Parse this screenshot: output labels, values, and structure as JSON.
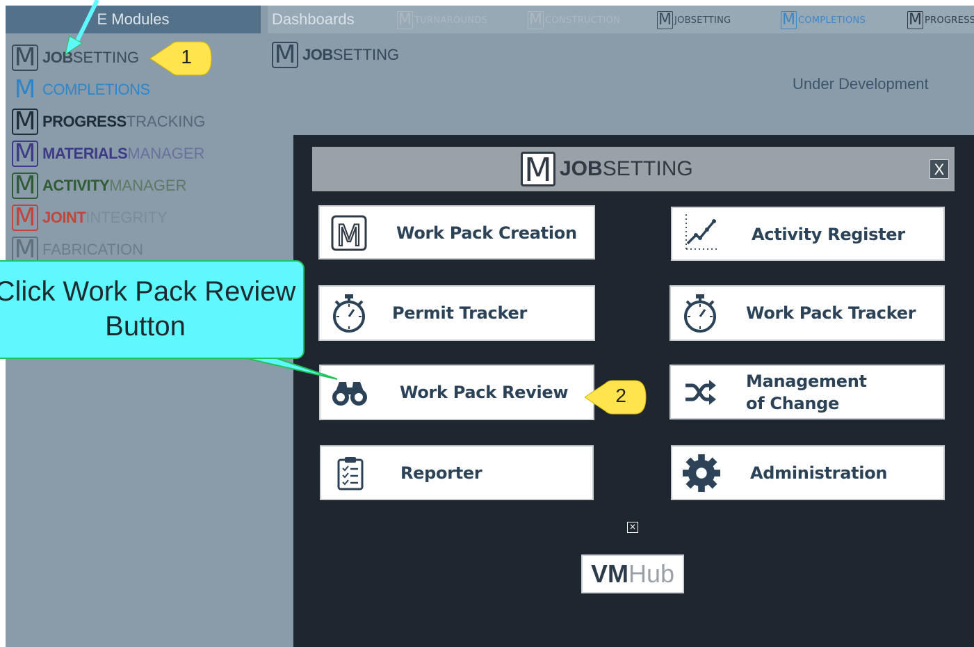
{
  "modules_header": "E Modules",
  "topnav": {
    "dashboards": "Dashboards",
    "modules": [
      {
        "m": "M",
        "label": "TURNAROUNDS",
        "color": "#aeb8c1"
      },
      {
        "m": "M",
        "label": "CONSTRUCTION",
        "color": "#aeb8c1"
      },
      {
        "m": "M",
        "label": "JOBSETTING",
        "color": "#3a4b5a"
      },
      {
        "m": "M",
        "label": "COMPLETIONS",
        "color": "#3a86c9"
      },
      {
        "m": "M",
        "label": "PROGRESS",
        "color": "#2f3a44"
      }
    ]
  },
  "sidebar": {
    "items": [
      {
        "m": "M",
        "bold": "JOB",
        "light": "SETTING",
        "color": "#3a4b5a",
        "light_color": "#3a4b5a"
      },
      {
        "m": "M",
        "bold": "COMPLETIONS",
        "light": "",
        "color": "#2c86cc",
        "light_color": "#2c86cc"
      },
      {
        "m": "M",
        "bold": "PROGRESS",
        "light": "TRACKING",
        "color": "#1f2d38",
        "light_color": "#55667a"
      },
      {
        "m": "M",
        "bold": "MATERIALS",
        "light": "MANAGER",
        "color": "#3f3a88",
        "light_color": "#6a6f9e"
      },
      {
        "m": "M",
        "bold": "ACTIVITY",
        "light": "MANAGER",
        "color": "#2f5b35",
        "light_color": "#5d7963"
      },
      {
        "m": "M",
        "bold": "JOINT",
        "light": "INTEGRITY",
        "color": "#c0463c",
        "light_color": "#7c8b98"
      },
      {
        "m": "M",
        "bold": "",
        "light": "FABRICATION",
        "color": "#5f6f7c",
        "light_color": "#6d7c89"
      }
    ]
  },
  "main": {
    "title_m": "M",
    "title_bold": "JOB",
    "title_light": "SETTING",
    "status": "Under Development"
  },
  "modal": {
    "logo_m": "M",
    "logo_bold": "JOB",
    "logo_light": "SETTING",
    "close": "X",
    "tiles": [
      {
        "label": "Work Pack Creation",
        "icon": "m-logo-icon"
      },
      {
        "label": "Activity Register",
        "icon": "chart-line-icon"
      },
      {
        "label": "Permit Tracker",
        "icon": "stopwatch-icon"
      },
      {
        "label": "Work Pack Tracker",
        "icon": "stopwatch-icon"
      },
      {
        "label": "Work Pack Review",
        "icon": "binoculars-icon"
      },
      {
        "label_line1": "Management",
        "label_line2": "of Change",
        "icon": "shuffle-icon"
      },
      {
        "label": "Reporter",
        "icon": "clipboard-list-icon"
      },
      {
        "label": "Administration",
        "icon": "gear-icon"
      }
    ],
    "broken_image": "×",
    "vmhub_a": "VM",
    "vmhub_b": "Hub"
  },
  "annotations": {
    "callout_line1": "Click Work Pack Review",
    "callout_line2": "Button",
    "badge1": "1",
    "badge2": "2"
  }
}
